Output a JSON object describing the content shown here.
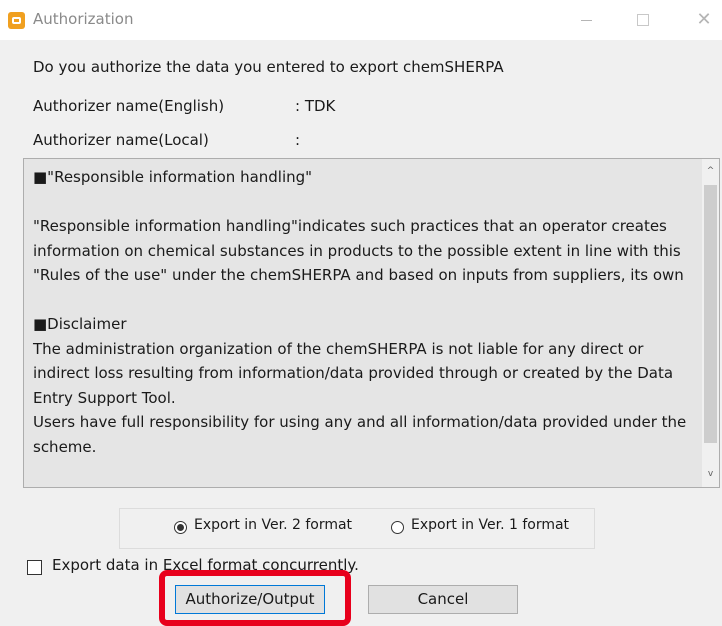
{
  "window": {
    "title": "Authorization",
    "minimize_glyph": "",
    "close_glyph": "✕",
    "icon": "chemsherpa-app-icon"
  },
  "prompt": "Do you authorize the data you entered to export chemSHERPA",
  "authorizer_english": {
    "label": "Authorizer name(English)",
    "colon": ":",
    "value": "TDK"
  },
  "authorizer_local": {
    "label": "Authorizer name(Local)",
    "colon": ":",
    "value": ""
  },
  "terms_text": "■\"Responsible information handling\"\n\n\"Responsible information handling\"indicates such practices that an operator creates information on chemical substances in products to the possible extent in line with this \"Rules of the use\" under the chemSHERPA and based on inputs from suppliers, its own\n\n■Disclaimer\nThe administration organization of the chemSHERPA is not liable for any direct or indirect loss resulting from information/data provided through or created by the Data Entry Support Tool.\nUsers have full responsibility for using any and all information/data provided under the scheme.",
  "scrollbar": {
    "up_glyph": "^",
    "down_glyph": "v"
  },
  "export_format": {
    "options": [
      {
        "label": "Export in Ver. 2 format",
        "selected": true
      },
      {
        "label": "Export in Ver. 1 format",
        "selected": false
      }
    ]
  },
  "excel_checkbox": {
    "label": "Export data in Excel format concurrently.",
    "checked": false
  },
  "buttons": {
    "authorize": "Authorize/Output",
    "cancel": "Cancel"
  },
  "colors": {
    "highlight": "#e8001c",
    "focus_border": "#0078d7",
    "app_icon": "#f0a020"
  }
}
